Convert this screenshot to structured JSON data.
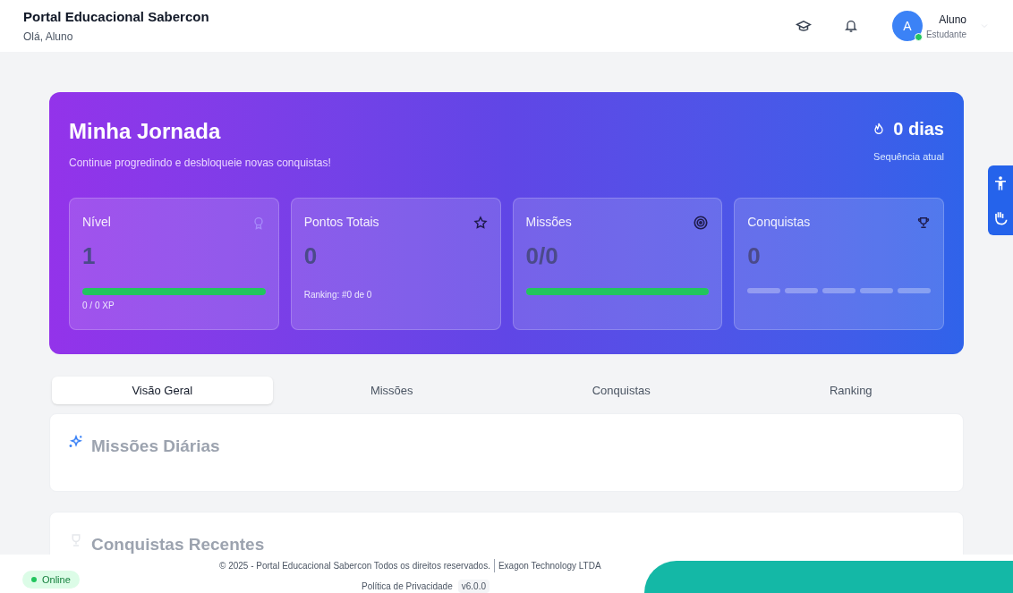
{
  "header": {
    "title": "Portal Educacional Sabercon",
    "greeting": "Olá, Aluno",
    "avatar_initial": "A",
    "user_name": "Aluno",
    "user_role": "Estudante",
    "online": true
  },
  "hero": {
    "title": "Minha Jornada",
    "subtitle": "Continue progredindo e desbloqueie novas conquistas!",
    "streak": "0 dias",
    "streak_label": "Sequência atual"
  },
  "stats": [
    {
      "kind": "bar",
      "label": "Nível",
      "value": "1",
      "level": 1,
      "caption": "0 / 0 XP"
    },
    {
      "kind": "text",
      "label": "Pontos Totais",
      "value": "0",
      "caption": "Ranking: #0 de 0"
    },
    {
      "kind": "bar",
      "label": "Missões",
      "value": "0/0",
      "level": 1
    },
    {
      "kind": "segments",
      "label": "Conquistas",
      "value": "0"
    }
  ],
  "tabs": [
    {
      "label": "Visão Geral",
      "selected": true
    },
    {
      "label": "Missões",
      "selected": false
    },
    {
      "label": "Conquistas",
      "selected": false
    },
    {
      "label": "Ranking",
      "selected": false
    }
  ],
  "sections": [
    {
      "title": "Missões Diárias"
    },
    {
      "title": "Conquistas Recentes"
    }
  ],
  "footer": {
    "status": "Online",
    "copyright": "© 2025 - Portal Educacional Sabercon Todos os direitos reservados.",
    "company": "Exagon Technology LTDA",
    "privacy": "Política de Privacidade",
    "version": "v6.0.0"
  }
}
